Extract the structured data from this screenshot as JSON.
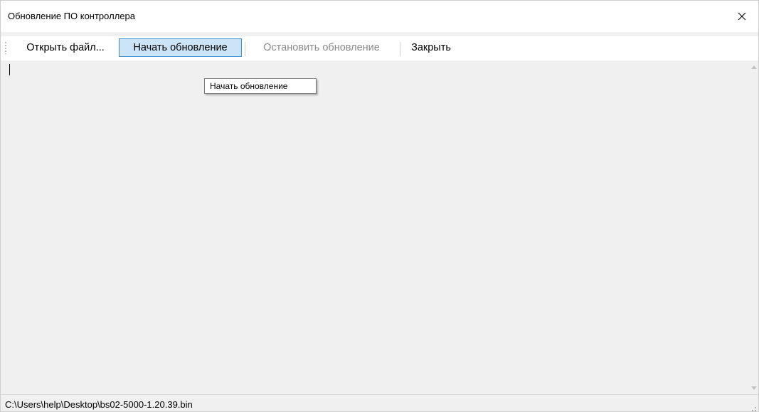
{
  "window": {
    "title": "Обновление ПО контроллера",
    "close_icon": "close-icon"
  },
  "toolbar": {
    "open_file": "Открыть файл...",
    "start_update": "Начать обновление",
    "stop_update": "Остановить обновление",
    "close": "Закрыть"
  },
  "tooltip": {
    "text": "Начать обновление"
  },
  "log": {
    "text": ""
  },
  "statusbar": {
    "file_path": "C:\\Users\\help\\Desktop\\bs02-5000-1.20.39.bin"
  },
  "colors": {
    "active_button_bg": "#cce4f7",
    "active_button_border": "#3f8fd4",
    "disabled_text": "#8a8a8a",
    "panel_bg": "#f0f0f0"
  }
}
